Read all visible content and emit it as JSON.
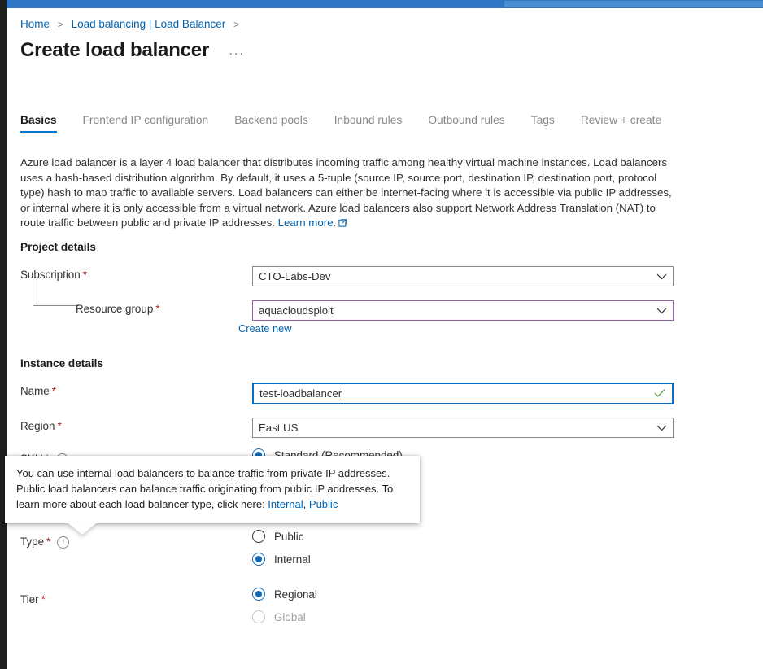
{
  "window": {
    "accent_color": "#2f76c7",
    "accent_color_light": "#4a8ed4",
    "rail_color": "#1e1e1e"
  },
  "breadcrumb": {
    "items": [
      {
        "label": "Home"
      },
      {
        "label": "Load balancing | Load Balancer"
      }
    ],
    "separator": ">"
  },
  "header": {
    "title": "Create load balancer",
    "more_label": "···"
  },
  "tabs": [
    {
      "label": "Basics",
      "active": true
    },
    {
      "label": "Frontend IP configuration",
      "active": false
    },
    {
      "label": "Backend pools",
      "active": false
    },
    {
      "label": "Inbound rules",
      "active": false
    },
    {
      "label": "Outbound rules",
      "active": false
    },
    {
      "label": "Tags",
      "active": false
    },
    {
      "label": "Review + create",
      "active": false
    }
  ],
  "description": {
    "body": "Azure load balancer is a layer 4 load balancer that distributes incoming traffic among healthy virtual machine instances. Load balancers uses a hash-based distribution algorithm. By default, it uses a 5-tuple (source IP, source port, destination IP, destination port, protocol type) hash to map traffic to available servers. Load balancers can either be internet-facing where it is accessible via public IP addresses, or internal where it is only accessible from a virtual network. Azure load balancers also support Network Address Translation (NAT) to route traffic between public and private IP addresses. ",
    "learn_more": "Learn more.",
    "learn_more_icon": "external-link-icon"
  },
  "project_details": {
    "heading": "Project details",
    "subscription": {
      "label": "Subscription",
      "required_marker": "*",
      "value": "CTO-Labs-Dev",
      "chevron_icon": "chevron-down-icon"
    },
    "resource_group": {
      "label": "Resource group",
      "required_marker": "*",
      "value": "aquacloudsploit",
      "border_color": "#a05fb4",
      "chevron_icon": "chevron-down-icon",
      "create_new_label": "Create new"
    }
  },
  "instance_details": {
    "heading": "Instance details",
    "name": {
      "label": "Name",
      "required_marker": "*",
      "value": "test-loadbalancer",
      "focus_border_color": "#0f6cbd",
      "validation_icon": "green-check-icon",
      "validation_color": "#5a9e4b"
    },
    "region": {
      "label": "Region",
      "required_marker": "*",
      "value": "East US",
      "chevron_icon": "chevron-down-icon"
    },
    "sku": {
      "label": "SKU",
      "required_marker": "*",
      "info_icon": "info-icon",
      "options": [
        {
          "label": "Standard (Recommended)",
          "selected": true,
          "disabled": false
        }
      ]
    },
    "type": {
      "label": "Type",
      "required_marker": "*",
      "info_icon": "info-icon",
      "options": [
        {
          "label": "Public",
          "selected": false,
          "disabled": false
        },
        {
          "label": "Internal",
          "selected": true,
          "disabled": false
        }
      ]
    },
    "tier": {
      "label": "Tier",
      "required_marker": "*",
      "options": [
        {
          "label": "Regional",
          "selected": true,
          "disabled": false
        },
        {
          "label": "Global",
          "selected": false,
          "disabled": true
        }
      ]
    }
  },
  "tooltip": {
    "text_before": "You can use internal load balancers to balance traffic from private IP addresses. Public load balancers can balance traffic originating from public IP addresses. To learn more about each load balancer type, click here: ",
    "link_internal": "Internal",
    "separator": ", ",
    "link_public": "Public"
  }
}
